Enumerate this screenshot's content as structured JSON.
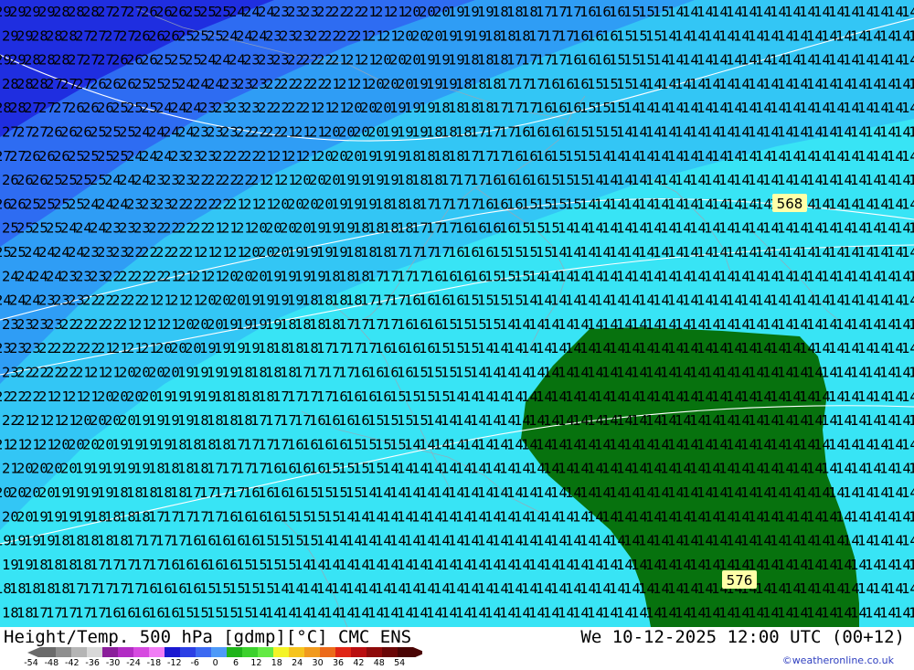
{
  "title": "Height/Temp. 500 hPa [gdmp][°C] CMC ENS",
  "datetime": "We 10-12-2025 12:00 UTC (00+12)",
  "credit": "©weatheronline.co.uk",
  "map": {
    "contour_labels": [
      "568",
      "576"
    ],
    "colors": {
      "deep_blue": "#1f2ee0",
      "blue": "#2e6cf2",
      "mid_blue": "#2f9df5",
      "light_blue": "#33c6f5",
      "cyan": "#38e4f5",
      "green": "#07720e",
      "contour_label_bg": "#ffffa8"
    }
  },
  "colorbar": {
    "ticks": [
      "-54",
      "-48",
      "-42",
      "-36",
      "-30",
      "-24",
      "-18",
      "-12",
      "-6",
      "0",
      "6",
      "12",
      "18",
      "24",
      "30",
      "36",
      "42",
      "48",
      "54"
    ],
    "colors": [
      "#6b6b6b",
      "#8f8f8f",
      "#b5b5b5",
      "#d8d8d8",
      "#8a1e9a",
      "#b22cc4",
      "#d64ae0",
      "#f07cf5",
      "#1b18d0",
      "#2b3fe5",
      "#3c6af2",
      "#4e9af8",
      "#1fb41a",
      "#3cd12d",
      "#63ea44",
      "#f4f428",
      "#f6c41e",
      "#f19a1d",
      "#ec6a1a",
      "#e02515",
      "#b90e10",
      "#8e0a0a",
      "#6a0606",
      "#4a0404"
    ]
  }
}
